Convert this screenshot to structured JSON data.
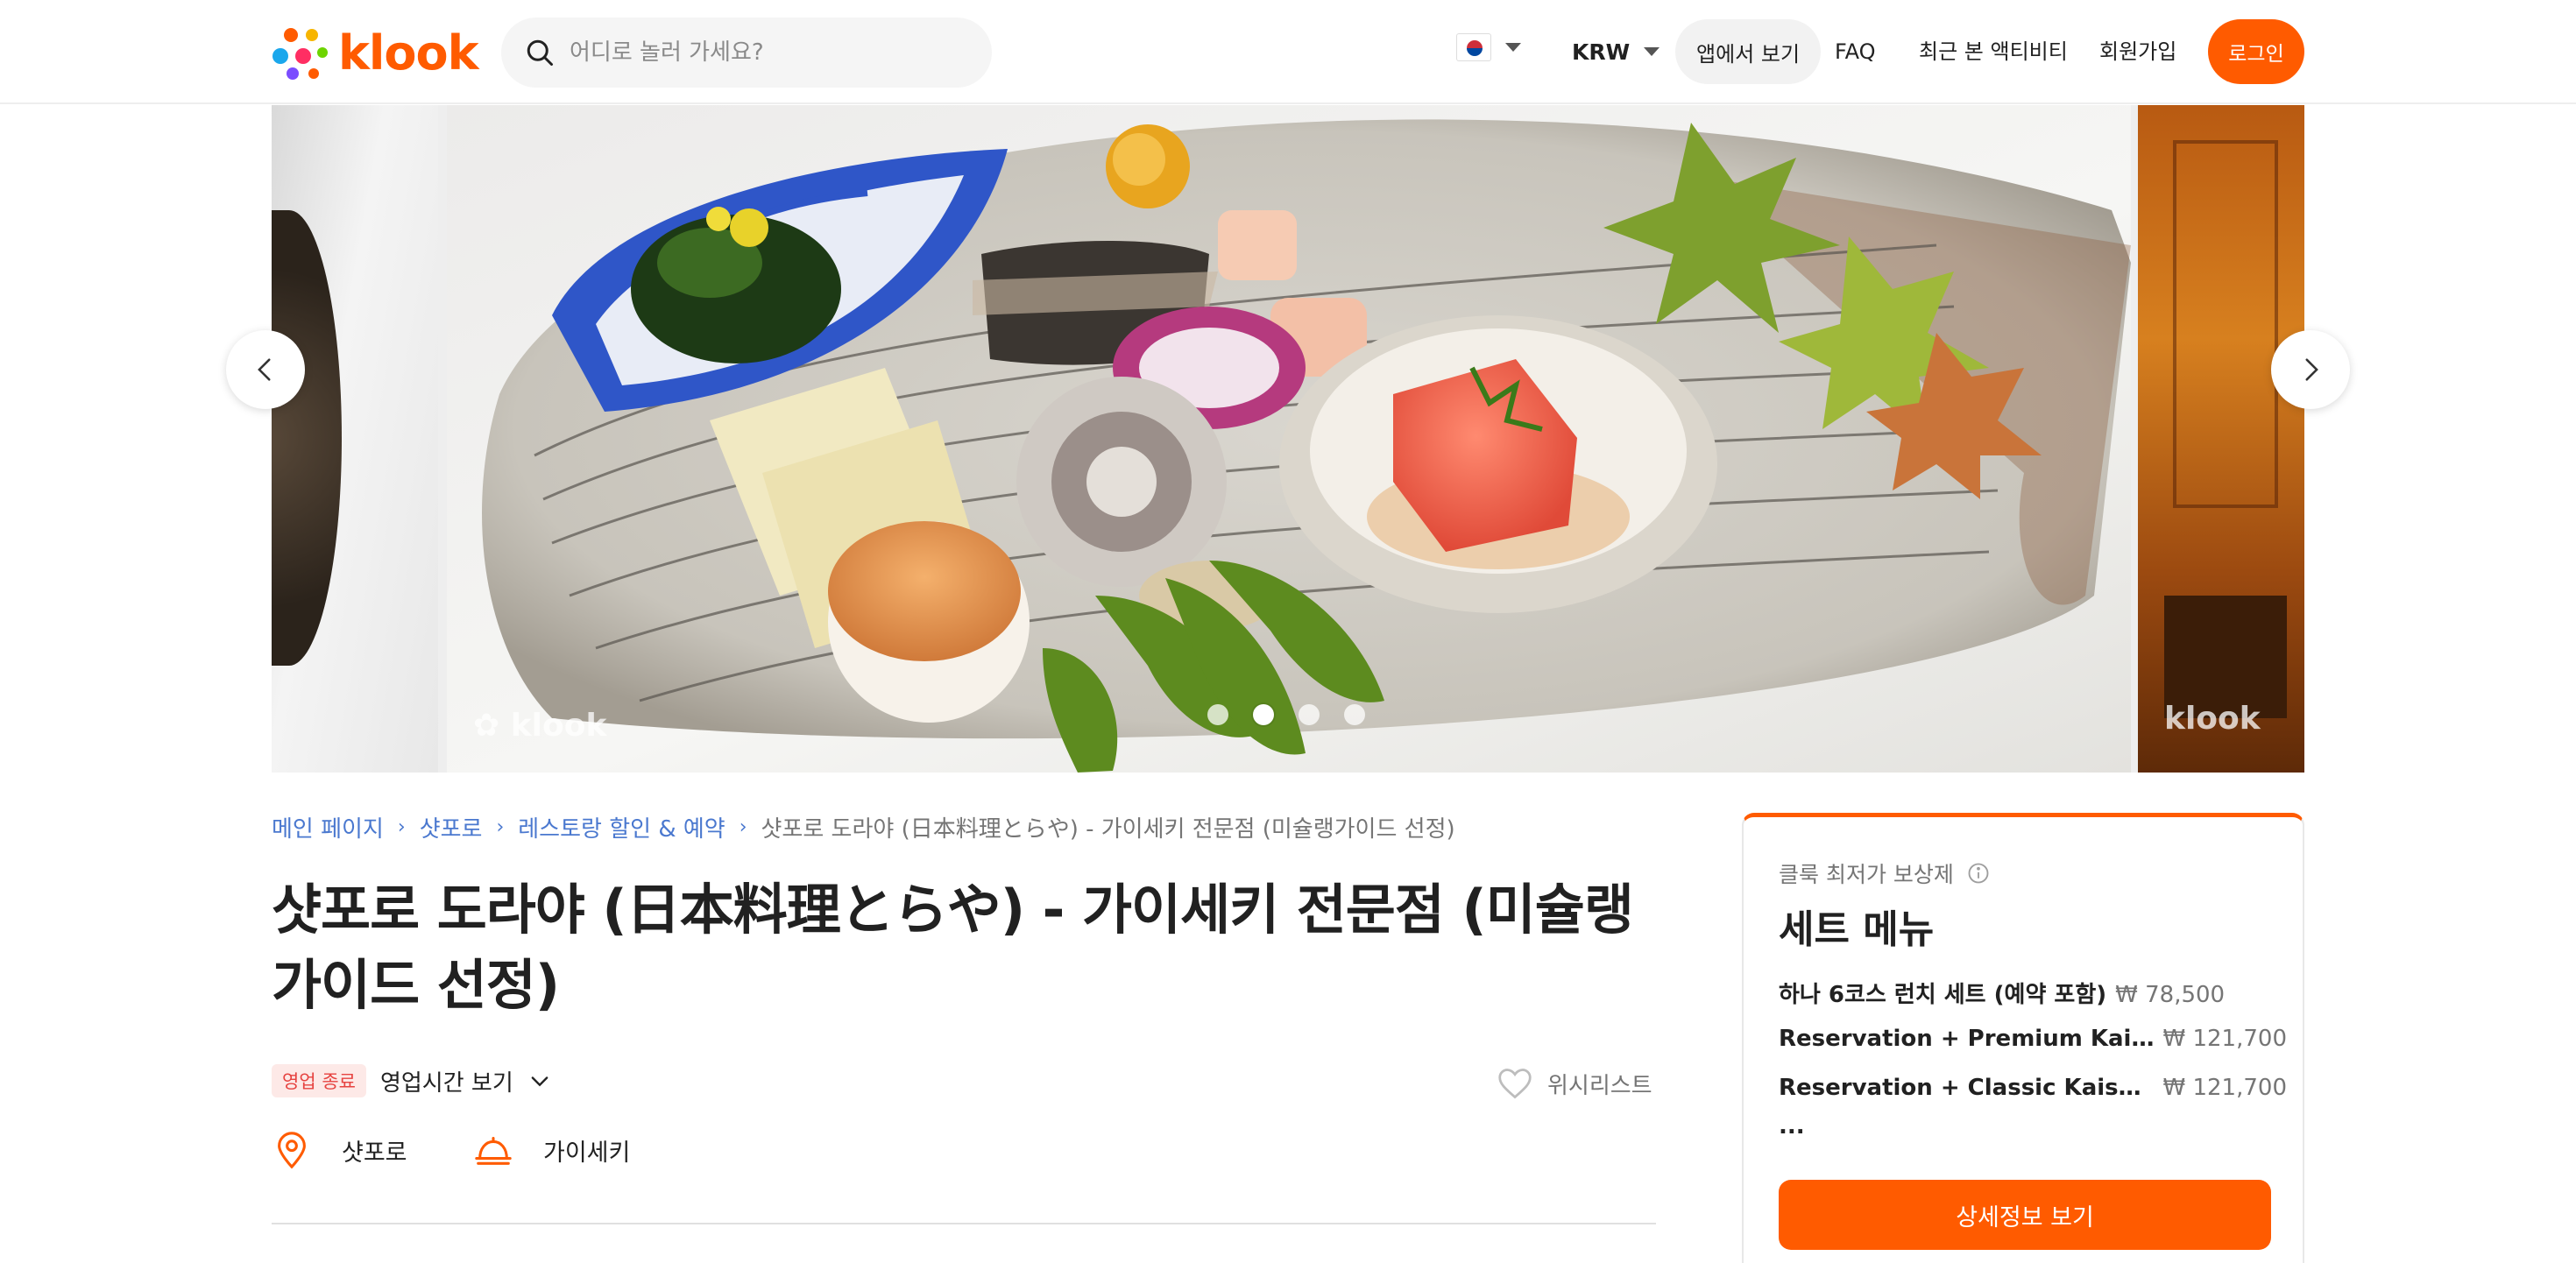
{
  "header": {
    "logo_text": "klook",
    "search_placeholder": "어디로 놀러 가세요?",
    "currency": "KRW",
    "app_link": "앱에서 보기",
    "faq": "FAQ",
    "recent": "최근 본 액티비티",
    "signup": "회원가입",
    "login": "로그인",
    "flag_icon": "korea-flag-icon"
  },
  "gallery": {
    "watermark": "klook",
    "slide_count": 4,
    "active_slide": 2
  },
  "breadcrumb": {
    "items": [
      "메인 페이지",
      "샷포로",
      "레스토랑 할인 & 예약"
    ],
    "current": "샷포로 도라야 (日本料理とらや) - 가이세키 전문점 (미슐랭가이드 선정)"
  },
  "title": "샷포로 도라야 (日本料理とらや) - 가이세키 전문점 (미슐랭가이드 선정)",
  "status": {
    "badge": "영업 종료",
    "hours_link": "영업시간 보기"
  },
  "wishlist": "위시리스트",
  "info": {
    "location": "샷포로",
    "category": "가이세키"
  },
  "card": {
    "subtitle": "클룩 최저가 보상제",
    "title": "세트 메뉴",
    "items": [
      {
        "name": "하나 6코스 런치 세트 (예약 포함)",
        "price": "₩ 78,500"
      },
      {
        "name": "Reservation + Premium Kais...",
        "price": "₩ 121,700"
      },
      {
        "name": "Reservation + Classic Kaisek...",
        "price": "₩ 121,700"
      }
    ],
    "more": "...",
    "button": "상세정보 보기"
  },
  "colors": {
    "brand": "#ff5b00",
    "link": "#4a78cf",
    "closed_badge_bg": "#fde9e7",
    "closed_badge_text": "#e64340"
  }
}
